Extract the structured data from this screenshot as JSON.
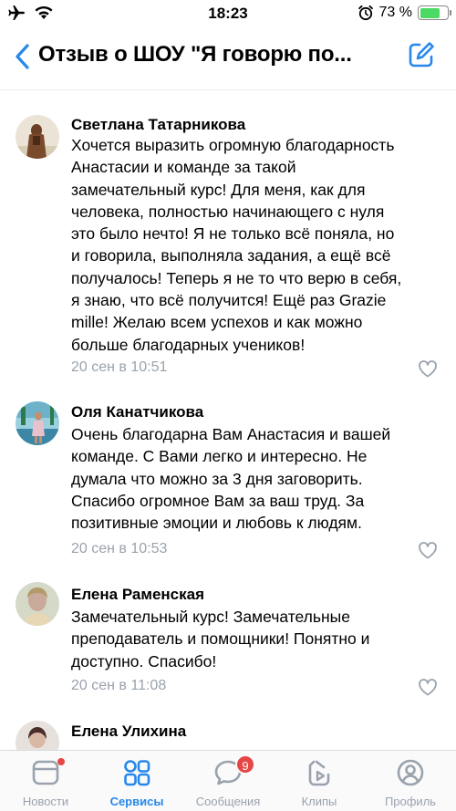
{
  "status_bar": {
    "time": "18:23",
    "battery_text": "73 %",
    "battery_level": 0.73
  },
  "header": {
    "title": "Отзыв о ШОУ \"Я говорю по..."
  },
  "comments": [
    {
      "author": "Светлана Татарникова",
      "text_lines": [
        "Хочется выразить огромную благодарность",
        "Анастасии и команде за такой",
        "замечательный курс! Для меня, как для",
        "человека, полностью начинающего с нуля",
        "это было нечто! Я не только всё поняла, но",
        "и говорила, выполняла задания, а ещё всё",
        "получалось! Теперь я не то что верю в себя,",
        "я знаю, что всё получится! Ещё раз Grazie",
        "mille! Желаю всем успехов и как можно",
        "больше благодарных учеников!"
      ],
      "date": "20 сен в 10:51"
    },
    {
      "author": "Оля Канатчикова",
      "text_lines": [
        "Очень благодарна Вам Анастасия и вашей",
        "команде.  С  Вами легко  и интересно. Не",
        "думала что можно за 3 дня заговорить.",
        "Спасибо огромное Вам за ваш труд. За",
        "позитивные эмоции и любовь к людям."
      ],
      "date": "20 сен в 10:53"
    },
    {
      "author": "Елена Раменская",
      "text_lines": [
        "Замечательный курс! Замечательные",
        "преподаватель и помощники! Понятно и",
        "доступно. Спасибо!"
      ],
      "date": "20 сен в 11:08"
    },
    {
      "author": "Елена Улихина"
    }
  ],
  "tab_bar": {
    "tabs": [
      {
        "label": "Новости",
        "icon": "news-icon"
      },
      {
        "label": "Сервисы",
        "icon": "services-icon"
      },
      {
        "label": "Сообщения",
        "icon": "messages-icon",
        "badge": "9"
      },
      {
        "label": "Клипы",
        "icon": "clips-icon"
      },
      {
        "label": "Профиль",
        "icon": "profile-icon"
      }
    ],
    "active_tab": "Сервисы"
  },
  "colors": {
    "accent": "#2688eb",
    "secondary_text": "#99a2ad",
    "badge": "#e64646",
    "battery": "#4cd964"
  }
}
